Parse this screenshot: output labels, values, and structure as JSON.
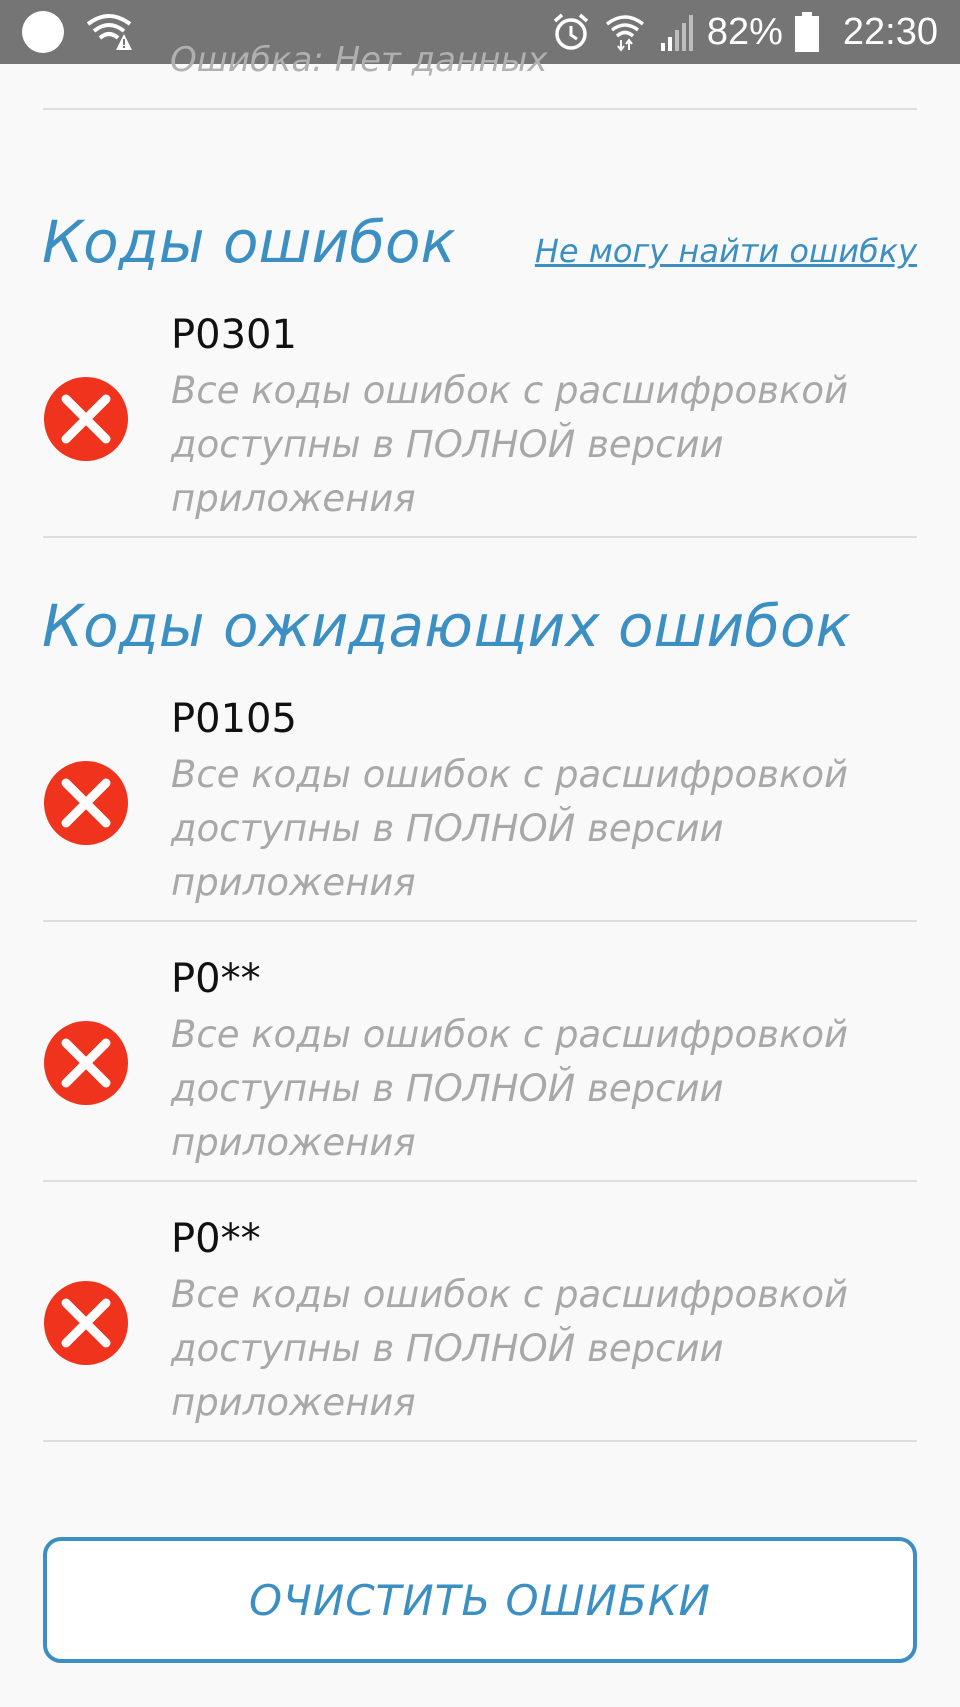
{
  "status_bar": {
    "battery_percent": "82%",
    "time": "22:30",
    "icons": [
      "notification-circle-icon",
      "wifi-warning-icon",
      "alarm-icon",
      "wifi-data-icon",
      "signal-icon",
      "battery-icon"
    ]
  },
  "top_cut_text": "Ошибка: Нет данных",
  "error_codes_section": {
    "title": "Коды ошибок",
    "help_link": "Не могу найти ошибку",
    "items": [
      {
        "code": "P0301",
        "description": "Все коды ошибок с расшифровкой доступны в ПОЛНОЙ версии приложения",
        "icon": "error-x-icon"
      }
    ]
  },
  "pending_codes_section": {
    "title": "Коды ожидающих ошибок",
    "items": [
      {
        "code": "P0105",
        "description": "Все коды ошибок с расшифровкой доступны в ПОЛНОЙ версии приложения",
        "icon": "error-x-icon"
      },
      {
        "code": "P0**",
        "description": "Все коды ошибок с расшифровкой доступны в ПОЛНОЙ версии приложения",
        "icon": "error-x-icon"
      },
      {
        "code": "P0**",
        "description": "Все коды ошибок с расшифровкой доступны в ПОЛНОЙ версии приложения",
        "icon": "error-x-icon"
      }
    ]
  },
  "clear_button_label": "ОЧИСТИТЬ ОШИБКИ",
  "colors": {
    "accent": "#3b8fc2",
    "error_red": "#f0331c",
    "status_bar": "#757575",
    "background": "#f9f9f9"
  }
}
